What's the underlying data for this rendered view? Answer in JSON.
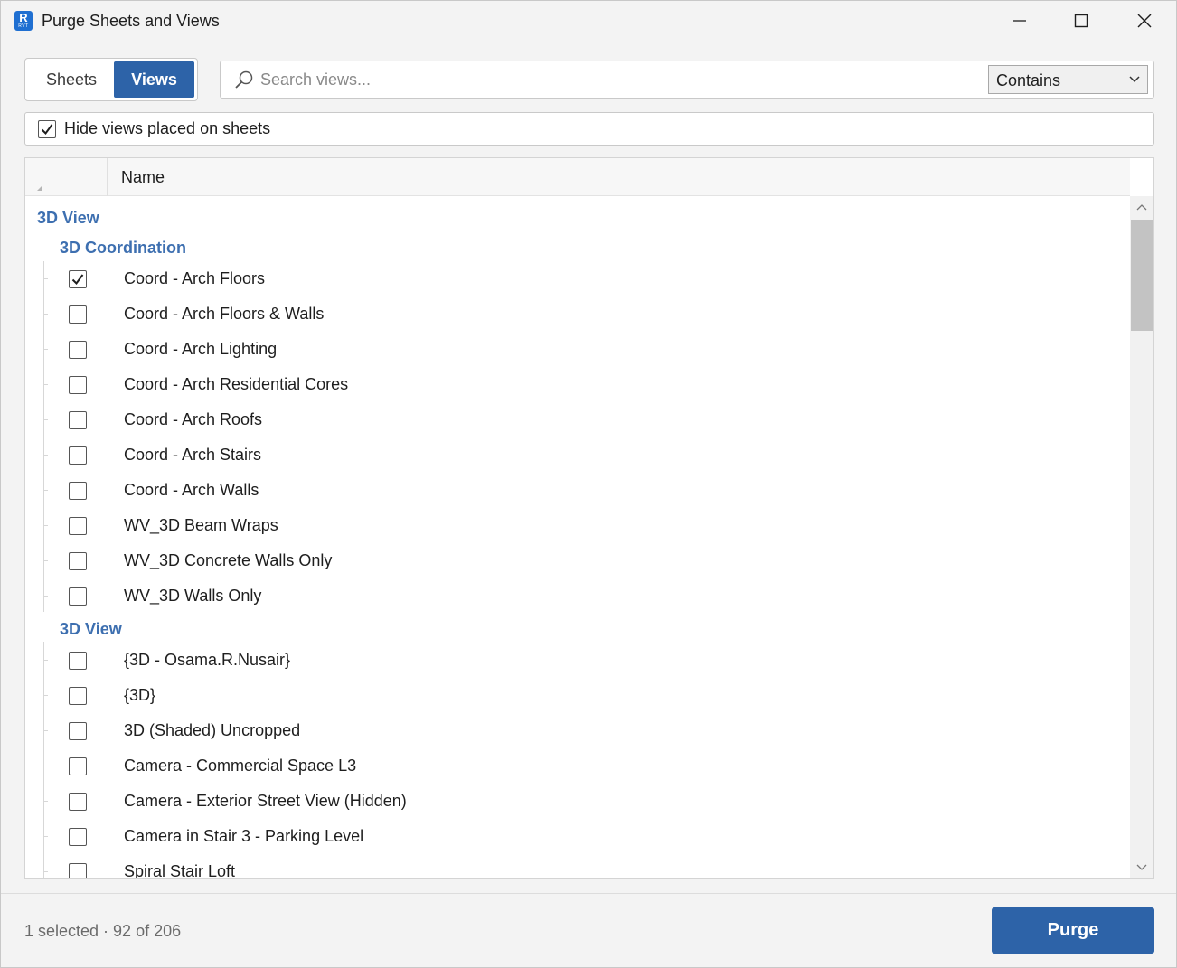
{
  "window": {
    "title": "Purge Sheets and Views",
    "app_icon_letter": "R",
    "app_icon_sub": "RVT",
    "app_icon_color": "#1f6fd1"
  },
  "tabs": [
    {
      "label": "Sheets",
      "selected": false
    },
    {
      "label": "Views",
      "selected": true
    }
  ],
  "search": {
    "placeholder": "Search views...",
    "value": "",
    "mode": "Contains"
  },
  "hide_option": {
    "label": "Hide views placed on sheets",
    "checked": true
  },
  "list": {
    "column_header": "Name",
    "top_group": "3D View",
    "subgroups": [
      {
        "label": "3D Coordination",
        "items": [
          {
            "label": "Coord - Arch Floors",
            "checked": true
          },
          {
            "label": "Coord - Arch Floors & Walls",
            "checked": false
          },
          {
            "label": "Coord - Arch Lighting",
            "checked": false
          },
          {
            "label": "Coord - Arch Residential Cores",
            "checked": false
          },
          {
            "label": "Coord - Arch Roofs",
            "checked": false
          },
          {
            "label": "Coord - Arch Stairs",
            "checked": false
          },
          {
            "label": "Coord - Arch Walls",
            "checked": false
          },
          {
            "label": "WV_3D Beam Wraps",
            "checked": false
          },
          {
            "label": "WV_3D Concrete Walls Only",
            "checked": false
          },
          {
            "label": "WV_3D Walls Only",
            "checked": false
          }
        ]
      },
      {
        "label": "3D View",
        "items": [
          {
            "label": "{3D - Osama.R.Nusair}",
            "checked": false
          },
          {
            "label": "{3D}",
            "checked": false
          },
          {
            "label": "3D (Shaded) Uncropped",
            "checked": false
          },
          {
            "label": "Camera - Commercial Space L3",
            "checked": false
          },
          {
            "label": "Camera - Exterior Street View (Hidden)",
            "checked": false
          },
          {
            "label": "Camera in Stair 3 - Parking Level",
            "checked": false
          },
          {
            "label": "Spiral Stair Loft",
            "checked": false
          }
        ]
      }
    ]
  },
  "footer": {
    "status": "1 selected · 92 of 206",
    "purge_label": "Purge"
  },
  "colors": {
    "accent": "#2d63a8",
    "group_text": "#3d6fb0"
  }
}
